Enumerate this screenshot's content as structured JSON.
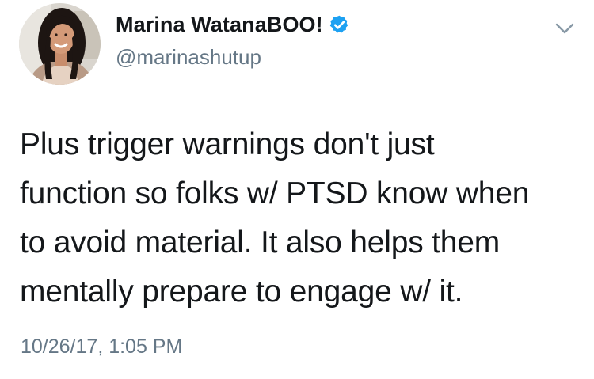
{
  "author": {
    "display_name": "Marina WatanaBOO!",
    "handle": "@marinashutup",
    "verified": true,
    "avatar_icon": "avatar-photo"
  },
  "tweet": {
    "text": "Plus trigger warnings don't just\nfunction so folks w/ PTSD know when\nto avoid material. It also helps them\nmentally prepare to engage w/ it.",
    "timestamp": "10/26/17, 1:05 PM"
  },
  "icons": {
    "verified": "verified-badge-icon",
    "menu": "chevron-down-icon"
  },
  "colors": {
    "text": "#14171a",
    "secondary": "#657786",
    "verified_blue": "#1da1f2",
    "background": "#ffffff"
  }
}
